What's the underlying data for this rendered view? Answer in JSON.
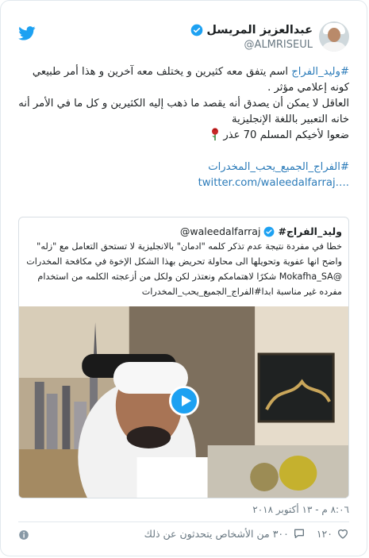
{
  "user": {
    "name": "عبدالعزيز المريسل",
    "handle": "@ALMRISEUL"
  },
  "tweet": {
    "hashtag1": "#وليد_الفراج",
    "line1_rest": " اسم يتفق معه كثيرين و يختلف معه آخرين و هذا أمر طبيعي كونه إعلامي مؤثر .",
    "line2": "العاقل لا يمكن أن يصدق أنه يقصد ما ذهب إليه الكثيرين و كل ما في الأمر أنه خانه التعبير باللغة الإنجليزية",
    "line3": "ضعوا لأخيكم المسلم 70 عذر",
    "hashtag2": "#الفراج_الجميع_يحب_المخدرات",
    "link": "twitter.com/waleedalfarraj…."
  },
  "quoted": {
    "name": "وليد_الفراج#",
    "handle": "@waleedalfarraj",
    "text1": "خطا في مفردة نتيجة عدم تذكر كلمه \"ادمان\" بالانجليزية لا تستحق التعامل مع \"زله\" واضح انها عفوية وتحويلها الى محاولة تحريض بهذا الشكل  الإخوة في مكافحة المخدرات",
    "text2": "@Mokafha_SA شكرًا لاهتمامكم ونعتذر لكن ولكل من أزعجته الكلمه من استخدام مفرده غير مناسبة ابدا#الفراج_الجميع_يحب_المخدرات"
  },
  "footer": {
    "timestamp": "٨:٠٦ م - ١٣ أكتوبر ٢٠١٨",
    "likes": "١٢٠",
    "talking": "٣٠٠ من الأشخاص يتحدثون عن ذلك"
  },
  "colors": {
    "accent": "#1da1f2",
    "link": "#2b7bb9",
    "muted": "#697882"
  }
}
